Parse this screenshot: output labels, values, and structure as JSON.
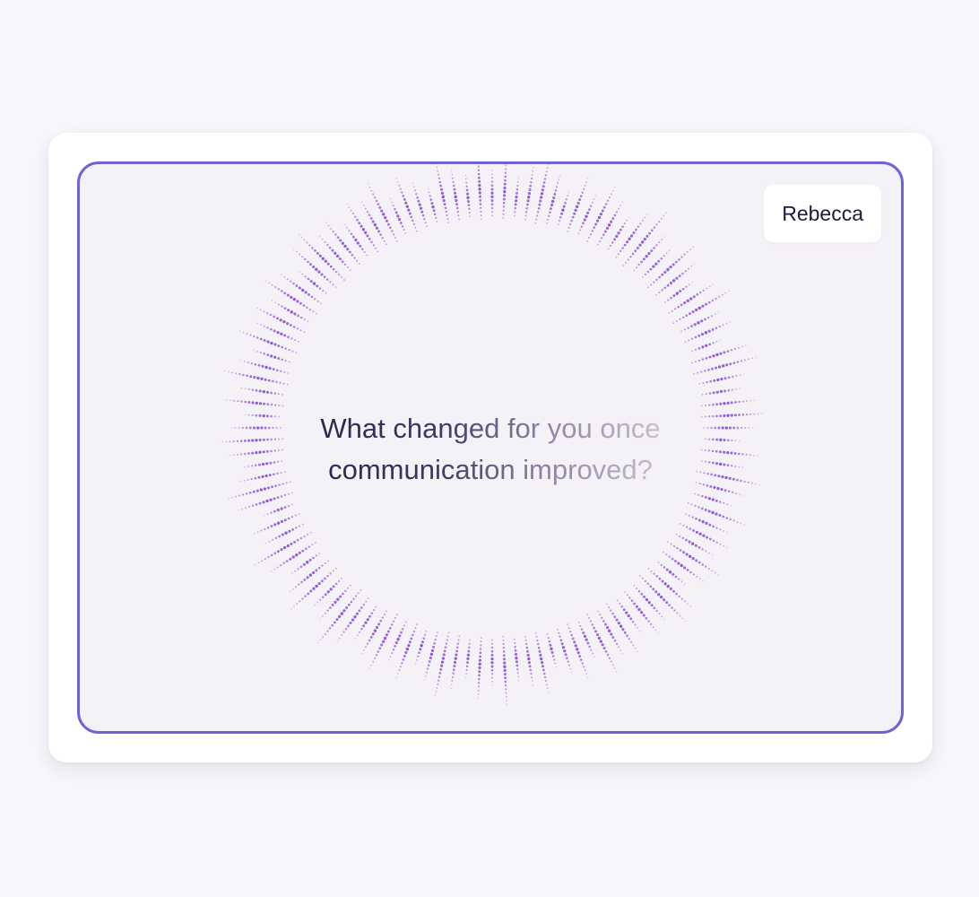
{
  "participant": {
    "name": "Rebecca"
  },
  "prompt": {
    "question": "What changed for you once\ncommunication improved?"
  },
  "theme": {
    "accent": "#6c63d9",
    "dots": "#8a4fd0",
    "stage_bg": "#f5f2f7",
    "page_bg": "#f8f7fc"
  },
  "visualizer": {
    "icon": "audio-radial-waveform-icon",
    "bars": 120,
    "levels": [
      0.55,
      0.8,
      0.42,
      0.7,
      0.9,
      0.6,
      0.35,
      0.75,
      0.5,
      0.85,
      0.62,
      0.4,
      0.7,
      0.95,
      0.58,
      0.45,
      0.8,
      0.66,
      0.38,
      0.72,
      0.88,
      0.5,
      0.64,
      0.3,
      0.78,
      0.92,
      0.56,
      0.44,
      0.7,
      0.83,
      0.6,
      0.36,
      0.74,
      0.52,
      0.9,
      0.65,
      0.4,
      0.81,
      0.57,
      0.69,
      0.47,
      0.86,
      0.62,
      0.33,
      0.76,
      0.91,
      0.54,
      0.68,
      0.41,
      0.79,
      0.6,
      0.87,
      0.45,
      0.73,
      0.58,
      0.38,
      0.84,
      0.66,
      0.5,
      0.94,
      0.55,
      0.8,
      0.42,
      0.7,
      0.9,
      0.6,
      0.35,
      0.75,
      0.5,
      0.85,
      0.62,
      0.4,
      0.7,
      0.95,
      0.58,
      0.45,
      0.8,
      0.66,
      0.38,
      0.72,
      0.88,
      0.5,
      0.64,
      0.3,
      0.78,
      0.92,
      0.56,
      0.44,
      0.7,
      0.83,
      0.6,
      0.36,
      0.74,
      0.52,
      0.9,
      0.65,
      0.4,
      0.81,
      0.57,
      0.69,
      0.47,
      0.86,
      0.62,
      0.33,
      0.76,
      0.91,
      0.54,
      0.68,
      0.41,
      0.79,
      0.6,
      0.87,
      0.45,
      0.73,
      0.58,
      0.38,
      0.84,
      0.66,
      0.5,
      0.94
    ]
  }
}
